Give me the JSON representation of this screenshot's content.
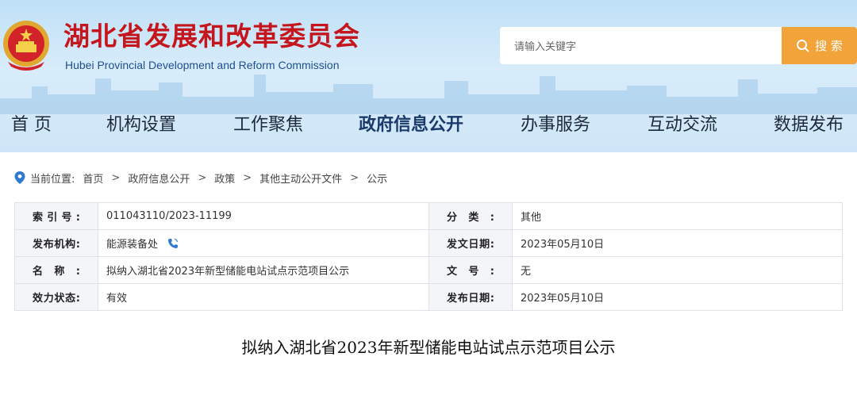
{
  "header": {
    "title": "湖北省发展和改革委员会",
    "subtitle": "Hubei Provincial Development and Reform Commission",
    "search_placeholder": "请输入关键字",
    "search_button": "搜 索"
  },
  "nav": {
    "items": [
      "首 页",
      "机构设置",
      "工作聚焦",
      "政府信息公开",
      "办事服务",
      "互动交流",
      "数据发布"
    ],
    "active": "政府信息公开"
  },
  "breadcrumb": {
    "prefix": "当前位置:",
    "items": [
      "首页",
      "政府信息公开",
      "政策",
      "其他主动公开文件",
      "公示"
    ],
    "separator": ">"
  },
  "meta": {
    "rows": [
      {
        "label1": "索引号:",
        "value1": "011043110/2023-11199",
        "label2": "分类:",
        "value2": "其他"
      },
      {
        "label1": "发布机构:",
        "value1": "能源装备处",
        "label2": "发文日期:",
        "value2": "2023年05月10日"
      },
      {
        "label1": "名称:",
        "value1": "拟纳入湖北省2023年新型储能电站试点示范项目公示",
        "label2": "文号:",
        "value2": "无"
      },
      {
        "label1": "效力状态:",
        "value1": "有效",
        "label2": "发布日期:",
        "value2": "2023年05月10日"
      }
    ]
  },
  "document": {
    "title": "拟纳入湖北省2023年新型储能电站试点示范项目公示"
  },
  "colors": {
    "title_red": "#c4161c",
    "search_orange": "#f2a33a",
    "nav_active": "#1a3a6b",
    "location_blue": "#2e7ad1"
  },
  "icons": [
    "national-emblem-icon",
    "search-icon",
    "location-pin-icon",
    "phone-icon"
  ]
}
